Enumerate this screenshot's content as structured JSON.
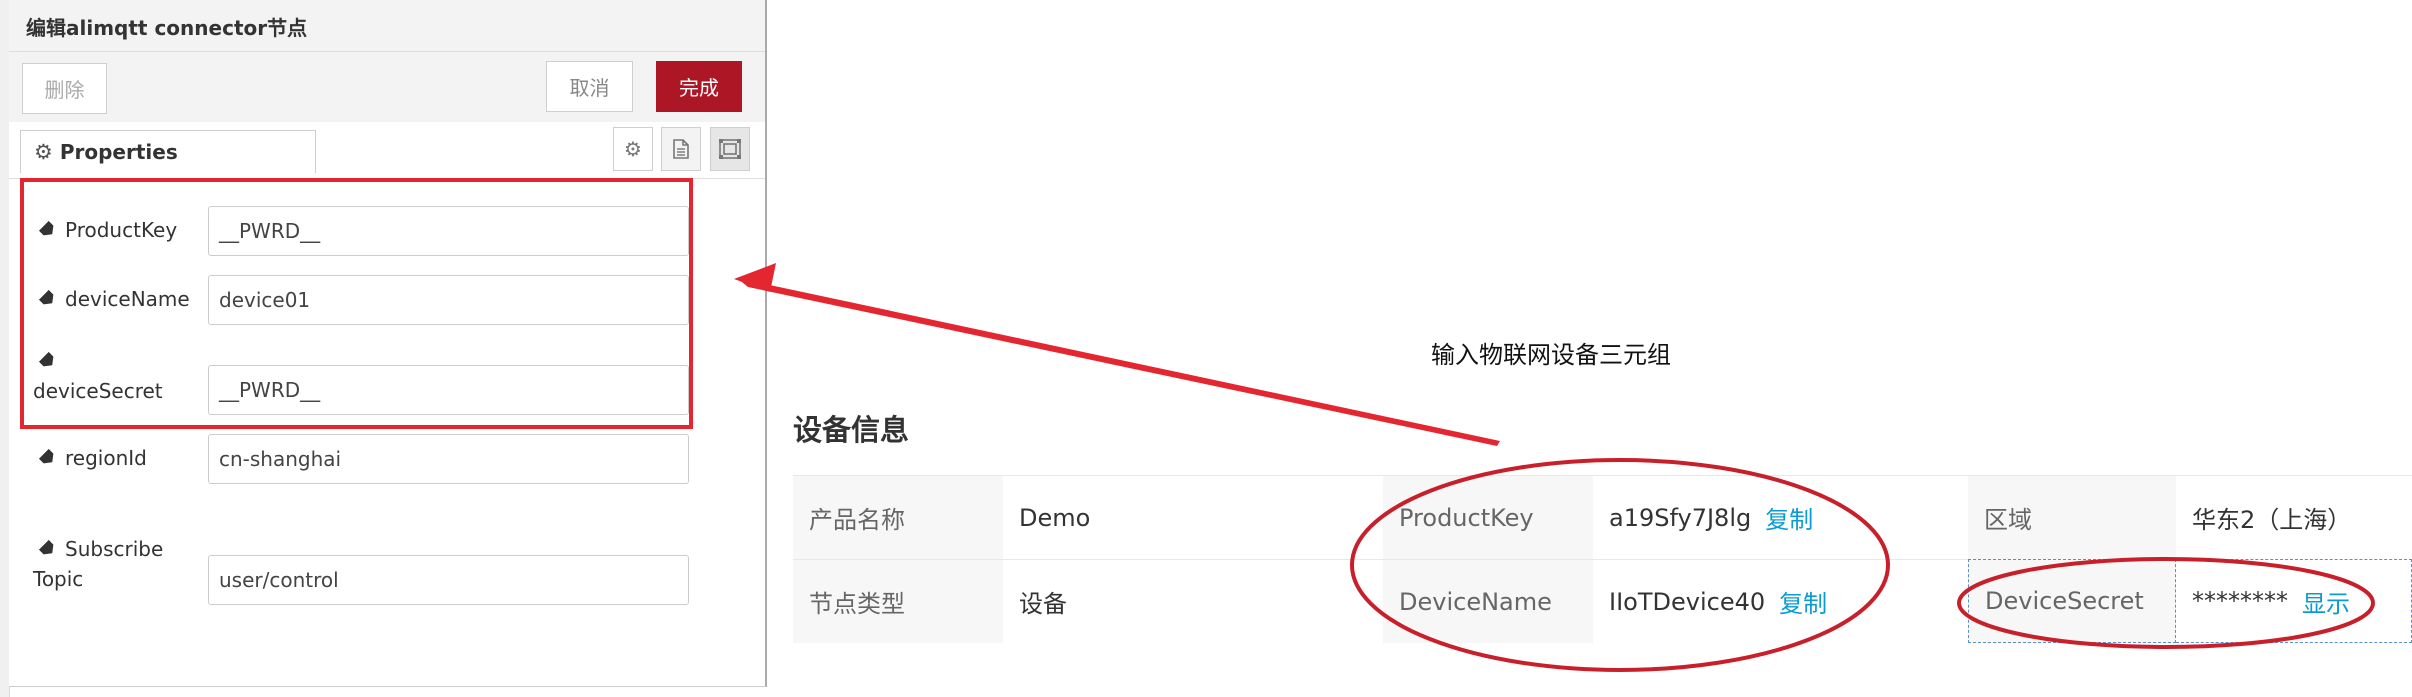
{
  "editor": {
    "title": "编辑alimqtt connector节点",
    "buttons": {
      "delete": "删除",
      "cancel": "取消",
      "done": "完成"
    },
    "tab_properties": "Properties",
    "fields": [
      {
        "label": "ProductKey",
        "value": "__PWRD__"
      },
      {
        "label": "deviceName",
        "value": "device01"
      },
      {
        "label": "deviceSecret",
        "value": "__PWRD__"
      },
      {
        "label": "regionId",
        "value": "cn-shanghai"
      },
      {
        "label_line1": "Subscribe",
        "label_line2": "Topic",
        "value": "user/control"
      }
    ]
  },
  "annotation": {
    "text": "输入物联网设备三元组",
    "color": "#e32630"
  },
  "device_info": {
    "title": "设备信息",
    "rows": [
      {
        "cells": [
          {
            "label": "产品名称",
            "value": "Demo"
          },
          {
            "label": "ProductKey",
            "value": "a19Sfy7J8lg",
            "action": "复制"
          },
          {
            "label": "区域",
            "value": "华东2（上海）"
          }
        ]
      },
      {
        "cells": [
          {
            "label": "节点类型",
            "value": "设备"
          },
          {
            "label": "DeviceName",
            "value": "IIoTDevice40",
            "action": "复制"
          },
          {
            "label": "DeviceSecret",
            "value": "********",
            "action": "显示"
          }
        ]
      }
    ]
  },
  "colors": {
    "accent": "#ad1625",
    "link": "#0a9bd3",
    "annotation": "#e32630"
  }
}
